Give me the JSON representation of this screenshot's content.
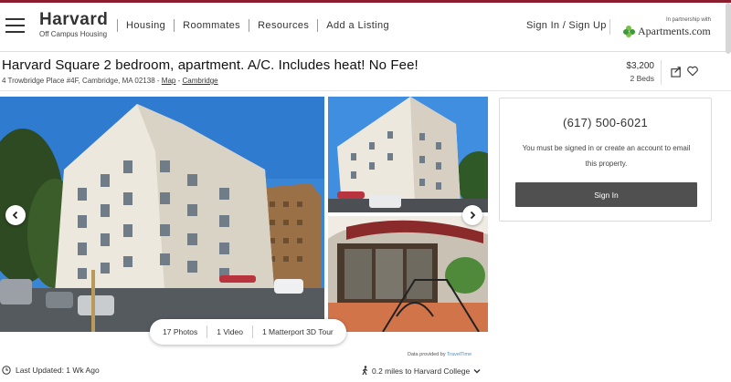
{
  "header": {
    "brand_title": "Harvard",
    "brand_subtitle": "Off Campus Housing",
    "nav": [
      "Housing",
      "Roommates",
      "Resources",
      "Add a Listing"
    ],
    "signin": "Sign In / Sign Up",
    "partner_small": "In partnership with",
    "partner_name": "Apartments.com"
  },
  "listing": {
    "title": "Harvard Square 2 bedroom, apartment. A/C. Includes heat! No Fee!",
    "address": "4 Trowbridge Place #4F, Cambridge, MA 02138 -",
    "map_link": "Map",
    "dash": "-",
    "area_link": "Cambridge",
    "price": "$3,200",
    "beds": "2 Beds"
  },
  "media": {
    "photos": "17 Photos",
    "video": "1 Video",
    "matterport": "1 Matterport 3D Tour",
    "data_provided_prefix": "Data provided by",
    "data_provided_source": "TravelTime"
  },
  "footer": {
    "last_updated": "Last Updated: 1 Wk Ago",
    "distance": "0.2 miles to Harvard College"
  },
  "contact": {
    "phone": "(617) 500-6021",
    "note": "You must be signed in or create an account to email this property.",
    "signin_button": "Sign In"
  },
  "colors": {
    "brand_crimson": "#8c1d2f",
    "button_dark": "#505050",
    "link_blue": "#4a90c2"
  }
}
